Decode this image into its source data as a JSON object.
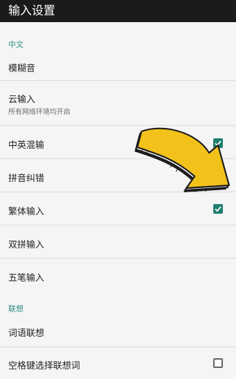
{
  "header": {
    "title": "输入设置"
  },
  "sections": [
    {
      "title": "中文"
    },
    {
      "title": "联想"
    }
  ],
  "rows": [
    {
      "label": "模糊音"
    },
    {
      "label": "云输入",
      "sub": "所有网络环境均开启"
    },
    {
      "label": "中英混输",
      "checked": true
    },
    {
      "label": "拼音纠错",
      "checked": true
    },
    {
      "label": "繁体输入",
      "checked": true
    },
    {
      "label": "双拼输入"
    },
    {
      "label": "五笔输入"
    },
    {
      "label": "词语联想"
    },
    {
      "label": "空格键选择联想词",
      "checked": false
    }
  ],
  "colors": {
    "accent": "#1f7f6f",
    "section": "#2a8f83",
    "arrow": "#f2c21b"
  },
  "icons": [
    "checkmark-icon",
    "pointing-arrow-icon"
  ]
}
